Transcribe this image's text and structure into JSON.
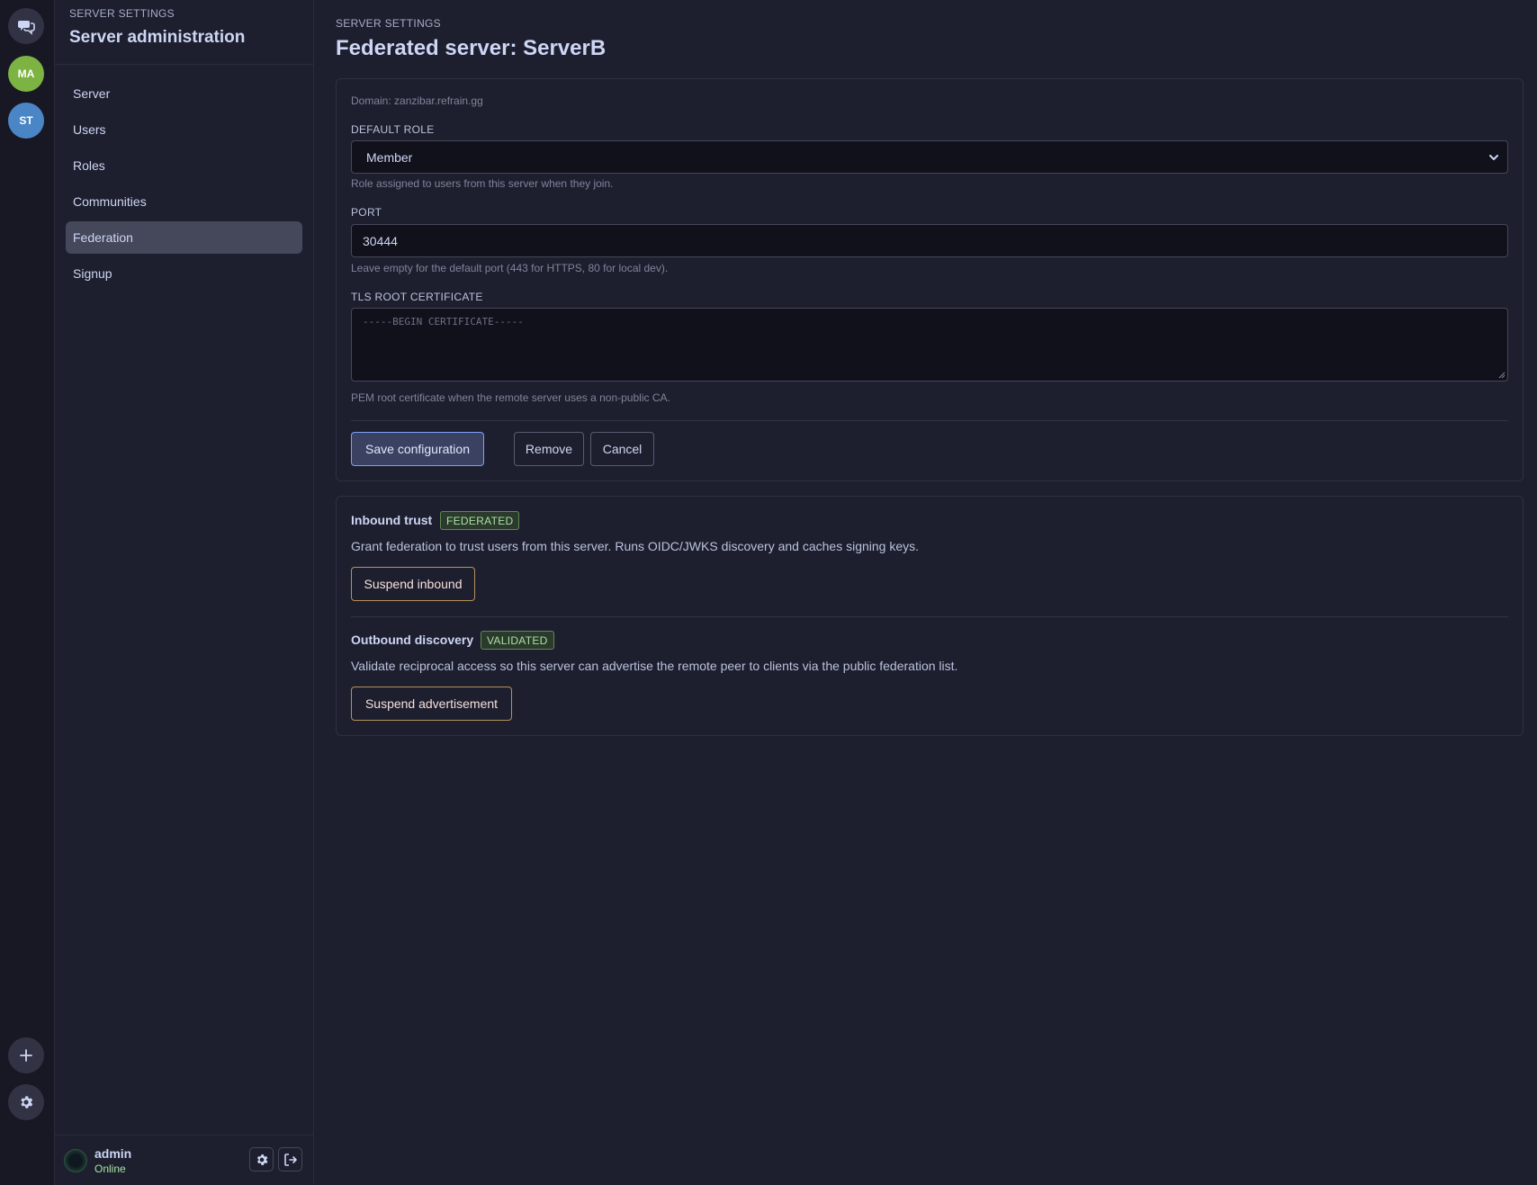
{
  "rail": {
    "ma_label": "MA",
    "st_label": "ST",
    "add_symbol": "+"
  },
  "sidebar": {
    "eyebrow": "SERVER SETTINGS",
    "title": "Server administration",
    "items": [
      {
        "label": "Server"
      },
      {
        "label": "Users"
      },
      {
        "label": "Roles"
      },
      {
        "label": "Communities"
      },
      {
        "label": "Federation"
      },
      {
        "label": "Signup"
      }
    ],
    "active_index": 4
  },
  "user": {
    "name": "admin",
    "status": "Online"
  },
  "main": {
    "eyebrow": "SERVER SETTINGS",
    "title": "Federated server: ServerB",
    "domain": "Domain: zanzibar.refrain.gg",
    "default_role": {
      "label": "DEFAULT ROLE",
      "value": "Member",
      "hint": "Role assigned to users from this server when they join."
    },
    "port": {
      "label": "PORT",
      "value": "30444",
      "hint": "Leave empty for the default port (443 for HTTPS, 80 for local dev)."
    },
    "tls": {
      "label": "TLS ROOT CERTIFICATE",
      "placeholder": "-----BEGIN CERTIFICATE-----",
      "hint": "PEM root certificate when the remote server uses a non-public CA."
    },
    "buttons": {
      "save": "Save configuration",
      "remove": "Remove",
      "cancel": "Cancel"
    },
    "inbound": {
      "title": "Inbound trust",
      "badge": "FEDERATED",
      "description": "Grant federation to trust users from this server. Runs OIDC/JWKS discovery and caches signing keys.",
      "button": "Suspend inbound"
    },
    "outbound": {
      "title": "Outbound discovery",
      "badge": "VALIDATED",
      "description": "Validate reciprocal access so this server can advertise the remote peer to clients via the public federation list.",
      "button": "Suspend advertisement"
    }
  },
  "colors": {
    "background": "#1e1f2e",
    "rail": "#181825",
    "accent_primary": "#7aa2f7",
    "badge_green": "#a6e3a1",
    "warn_border": "#b5915a",
    "avatar_ma": "#7cb342",
    "avatar_st": "#4a86c6"
  },
  "icons": [
    "chat-icon",
    "plus-icon",
    "gear-icon",
    "logout-icon",
    "chevron-down-icon"
  ]
}
